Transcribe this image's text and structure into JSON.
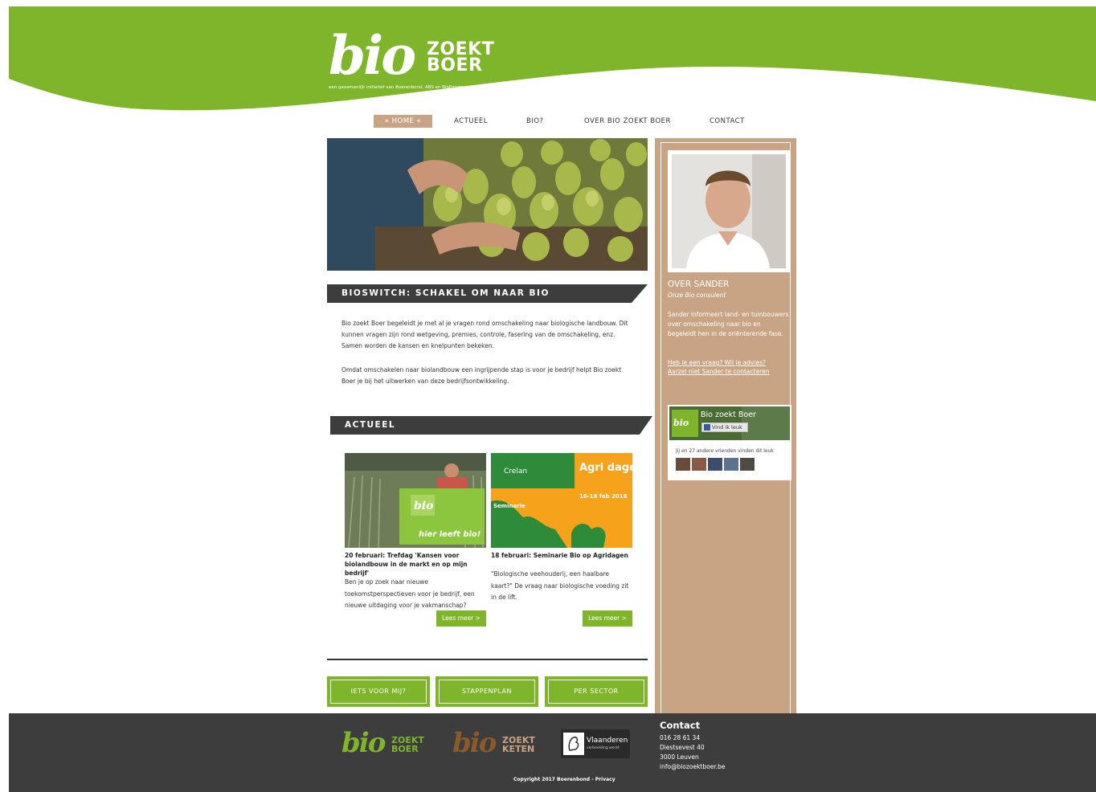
{
  "brand": {
    "logo_bio": "bio",
    "logo_zoekt": "ZOEKT",
    "logo_boer": "BOER",
    "tagline": "een gezamenlijk initiatief van Boerenbond, ABS en BioForum",
    "green": "#7fb52a",
    "tan": "#c9a484",
    "dark": "#3d3d3d"
  },
  "nav": {
    "items": [
      {
        "label": "» HOME «",
        "active": true
      },
      {
        "label": "ACTUEEL",
        "active": false
      },
      {
        "label": "BIO?",
        "active": false
      },
      {
        "label": "OVER BIO ZOEKT BOER",
        "active": false
      },
      {
        "label": "CONTACT",
        "active": false
      }
    ]
  },
  "slider": {
    "image": "pears-in-hands-photo",
    "slide_count": 2,
    "active_slide": 1
  },
  "intro": {
    "heading": "BIOSWITCH: SCHAKEL OM NAAR BIO",
    "paragraph1": "Bio zoekt Boer begeleidt je met al je vragen rond omschakeling naar biologische landbouw. Dit kunnen vragen zijn rond wetgeving, premies, controle, fasering van de omschakeling, enz. Samen worden de kansen en knelpunten bekeken.",
    "paragraph2": "Omdat omschakelen naar biolandbouw een ingrijpende stap is voor je bedrijf helpt Bio zoekt Boer je bij het uitwerken van deze bedrijfsontwikkeling."
  },
  "news": {
    "heading": "ACTUEEL",
    "items": [
      {
        "image": "farmer-with-bio-sign-photo",
        "sign_text": "hier leeft bio!",
        "title": "20 februari: Trefdag 'Kansen voor biolandbouw in de markt en op mijn bedrijf'",
        "text": "Ben je op zoek naar nieuwe toekomstperspectieven voor je bedrijf, een nieuwe uitdaging voor je vakmanschap?",
        "button": "Lees meer >"
      },
      {
        "image": "agridagen-seminar-banner",
        "banner_brand": "Crelan",
        "banner_title": "Agri dagen",
        "banner_seminar": "Seminarie",
        "banner_dates": "16-18 feb 2018",
        "title": "18 februari: Seminarie Bio op Agridagen",
        "text": "\"Biologische veehouderij, een haalbare kaart?\" De vraag naar biologische voeding zit in de lift.",
        "button": "Lees meer >"
      }
    ]
  },
  "cta": {
    "buttons": [
      "IETS VOOR MIJ?",
      "STAPPENPLAN",
      "PER SECTOR"
    ]
  },
  "sidebar": {
    "portrait": "sander-portrait-photo",
    "heading": "OVER SANDER",
    "subtitle": "Onze Bio consulent",
    "text": "Sander informeert land- en tuinbouwers over omschakeling naar bio en begeleidt hen in de oriënterende fase.",
    "link1": "Heb je een vraag? Wil je advies?",
    "link2": "Aarzel niet Sander te contacteren"
  },
  "facebook": {
    "page_name": "Bio zoekt Boer",
    "like_label": "Vind ik leuk",
    "friends_text": "Jij en 27 andere vrienden vinden dit leuk",
    "face_count": 5
  },
  "footer": {
    "logo1_bio": "bio",
    "logo1_a": "ZOEKT",
    "logo1_b": "BOER",
    "logo2_bio": "bio",
    "logo2_a": "ZOEKT",
    "logo2_b": "KETEN",
    "vlaanderen": "Vlaanderen",
    "vlaanderen_sub": "verbeelding werkt",
    "contact_heading": "Contact",
    "phone": "016 28 61 34",
    "street": "Diestsevest 40",
    "city": "3000 Leuven",
    "email": "info@biozoektboer.be",
    "copyright": "Copyright 2017 Boerenbond - Privacy"
  }
}
